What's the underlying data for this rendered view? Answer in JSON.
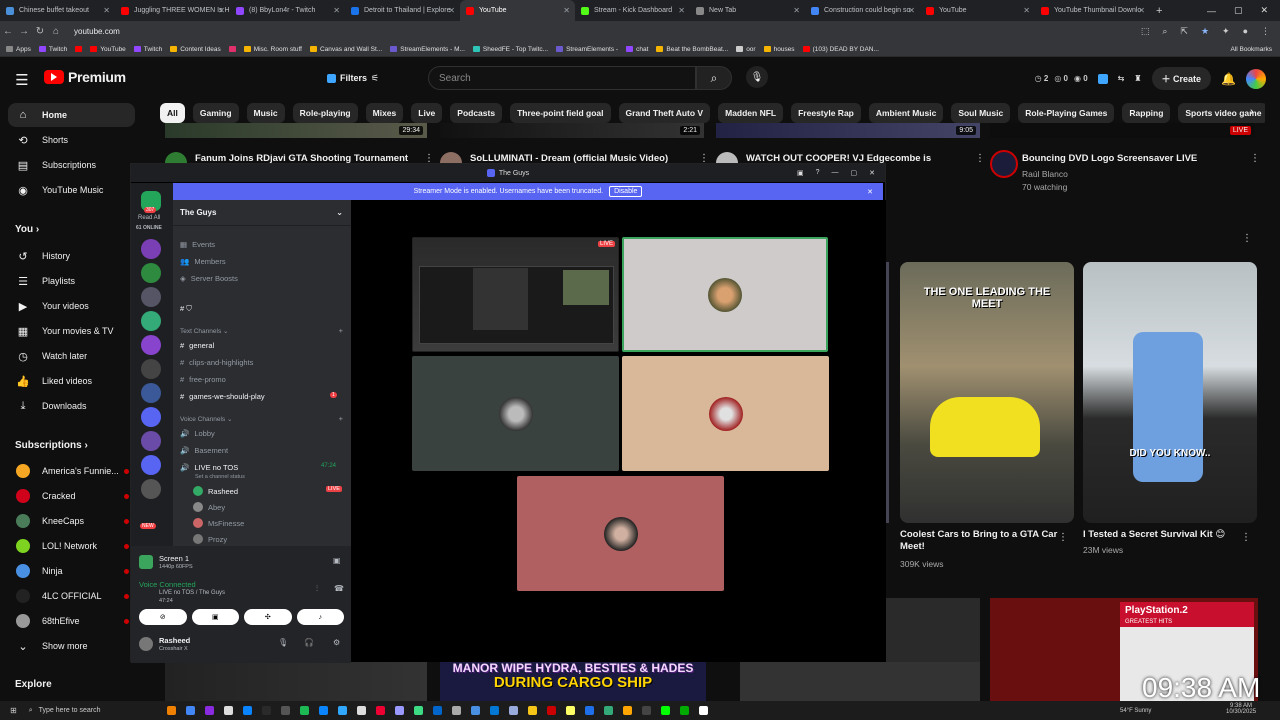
{
  "browser": {
    "tabs": [
      {
        "label": "Chinese buffet takeout",
        "color": "#4a90d9"
      },
      {
        "label": "Juggling THREE WOMEN Is H",
        "color": "#ff0000"
      },
      {
        "label": "(8) BbyLon4r - Twitch",
        "color": "#9146ff"
      },
      {
        "label": "Detroit to Thailand | Explore",
        "color": "#1a73e8"
      },
      {
        "label": "YouTube",
        "color": "#ff0000"
      },
      {
        "label": "Stream - Kick Dashboard",
        "color": "#53fc18"
      },
      {
        "label": "New Tab",
        "color": "#888888"
      },
      {
        "label": "Construction could begin so",
        "color": "#4285f4"
      },
      {
        "label": "YouTube",
        "color": "#ff0000"
      },
      {
        "label": "YouTube Thumbnail Downlo",
        "color": "#ff0000"
      }
    ],
    "new_tab": "+",
    "url": "youtube.com",
    "bookmarks": [
      {
        "label": "Apps",
        "color": "#888"
      },
      {
        "label": "Twitch",
        "color": "#9146ff"
      },
      {
        "label": "",
        "color": "#ff0000"
      },
      {
        "label": "YouTube",
        "color": "#ff0000"
      },
      {
        "label": "Twitch",
        "color": "#9146ff"
      },
      {
        "label": "Content Ideas",
        "color": "#f4b400"
      },
      {
        "label": "",
        "color": "#e1306c"
      },
      {
        "label": "Misc. Room stuff",
        "color": "#f4b400"
      },
      {
        "label": "Canvas and Wall St...",
        "color": "#f4b400"
      },
      {
        "label": "StreamElements - M...",
        "color": "#6a5acd"
      },
      {
        "label": "SheedFE - Top Twitc...",
        "color": "#2ec4b6"
      },
      {
        "label": "StreamElements -",
        "color": "#6a5acd"
      },
      {
        "label": "chat",
        "color": "#9146ff"
      },
      {
        "label": "Beat the BombBeat...",
        "color": "#f4b400"
      },
      {
        "label": "oor",
        "color": "#ccc"
      },
      {
        "label": "houses",
        "color": "#f4b400"
      },
      {
        "label": "(103) DEAD BY DAN...",
        "color": "#ff0000"
      }
    ],
    "all_bookmarks": "All Bookmarks"
  },
  "yt": {
    "logo": "Premium",
    "filters": "Filters",
    "search_placeholder": "Search",
    "stats": [
      "2",
      "0",
      "0"
    ],
    "create": "Create",
    "sidebar": {
      "main": [
        "Home",
        "Shorts",
        "Subscriptions",
        "YouTube Music"
      ],
      "you_head": "You",
      "you": [
        "History",
        "Playlists",
        "Your videos",
        "Your movies & TV",
        "Watch later",
        "Liked videos",
        "Downloads"
      ],
      "subs_head": "Subscriptions",
      "subs": [
        {
          "name": "America's Funnie...",
          "color": "#f5a623"
        },
        {
          "name": "Cracked",
          "color": "#d0021b"
        },
        {
          "name": "KneeCaps",
          "color": "#4a7c59"
        },
        {
          "name": "LOL! Network",
          "color": "#7ed321"
        },
        {
          "name": "Ninja",
          "color": "#4a90e2"
        },
        {
          "name": "4LC OFFICIAL",
          "color": "#222"
        },
        {
          "name": "68thEfive",
          "color": "#999"
        }
      ],
      "show_more": "Show more",
      "explore": "Explore"
    },
    "chips": [
      "All",
      "Gaming",
      "Music",
      "Role-playing",
      "Mixes",
      "Live",
      "Podcasts",
      "Three-point field goal",
      "Grand Theft Auto V",
      "Madden NFL",
      "Freestyle Rap",
      "Ambient Music",
      "Soul Music",
      "Role-Playing Games",
      "Rapping",
      "Sports video game"
    ],
    "row1": [
      {
        "title": "Fanum Joins RDjavi GTA Shooting Tournament",
        "dur": "29:34"
      },
      {
        "title": "SoLLUMINATI - Dream (official Music Video)",
        "dur": "2:21"
      },
      {
        "title": "WATCH OUT COOPER! VJ Edgecombe is",
        "dur": "9:05"
      },
      {
        "title": "Bouncing DVD Logo Screensaver LIVE",
        "channel": "Raúl Blanco",
        "meta": "70 watching",
        "badge": "LIVE"
      }
    ],
    "shorts": [
      {
        "title": "Coolest Cars to Bring to a GTA Car Meet!",
        "views": "309K views",
        "overlay": "THE ONE LEADING THE MEET"
      },
      {
        "title": "I Tested a Secret Survival Kit 😊",
        "views": "23M views",
        "overlay": "DID YOU KNOW.."
      }
    ],
    "row3_thumb_text": [
      "MANOR WIPE HYDRA, BESTIES & HADES",
      "DURING CARGO SHIP"
    ],
    "ps2_text": "PlayStation.2",
    "ps2_sub": "GREATEST HITS"
  },
  "discord": {
    "window_title": "The Guys",
    "banner": "Streamer Mode is enabled. Usernames have been truncated.",
    "banner_btn": "Disable",
    "rail_badge": "307",
    "read_all": "Read All",
    "online": "61 ONLINE",
    "server": "The Guys",
    "items": [
      "Events",
      "Members",
      "Server Boosts"
    ],
    "text_cat": "Text Channels",
    "text_channels": [
      {
        "name": "general",
        "hl": true
      },
      {
        "name": "clips-and-highlights",
        "hl": false
      },
      {
        "name": "free-promo",
        "hl": false
      },
      {
        "name": "games-we-should-play",
        "hl": true,
        "badge": "1"
      }
    ],
    "voice_cat": "Voice Channels",
    "voice_channels": [
      "Lobby",
      "Basement"
    ],
    "live_channel": "LIVE no TOS",
    "live_timer": "47:24",
    "live_status": "Set a channel status",
    "voice_users": [
      {
        "name": "Rasheed",
        "live": "LIVE",
        "color": "#3a6"
      },
      {
        "name": "Abey",
        "color": "#888"
      },
      {
        "name": "MsFinesse",
        "color": "#c66"
      },
      {
        "name": "Prozy",
        "color": "#777"
      }
    ],
    "screen_label": "Screen 1",
    "screen_sub": "1440p 60FPS",
    "voice_connected": "Voice Connected",
    "voice_path": "LIVE no TOS / The Guys",
    "voice_time": "47:24",
    "user": "Rasheed",
    "user_status": "Crosshair X",
    "new_badge": "NEW"
  },
  "taskbar": {
    "search": "Type here to search",
    "weather": "54°F  Sunny",
    "time": "9:38 AM",
    "date": "10/30/2025",
    "big_clock": "09:38 AM"
  }
}
